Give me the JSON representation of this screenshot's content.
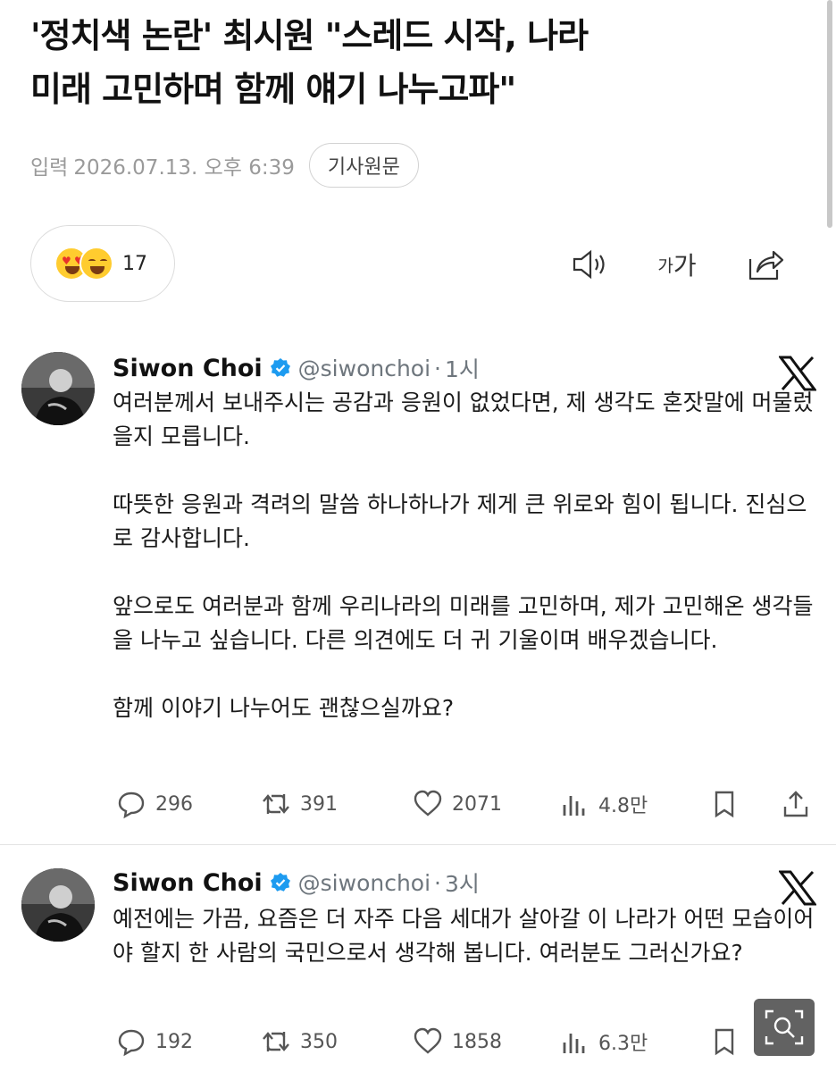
{
  "article": {
    "headline_line1": "'정치색 논란' 최시원 \"스레드 시작, 나라",
    "headline_line2": "미래 고민하며 함께 얘기 나누고파\"",
    "date_prefix": "입력",
    "date": "2026.07.13. 오후 6:39",
    "original_button": "기사원문",
    "reaction_count": "17",
    "font_size_small": "가",
    "font_size_large": "가"
  },
  "tweets": [
    {
      "name": "Siwon Choi",
      "handle": "@siwonchoi",
      "separator": "·",
      "time": "1시",
      "paragraphs": [
        "여러분께서 보내주시는 공감과 응원이 없었다면, 제 생각도 혼잣말에 머물렀을지 모릅니다.",
        "따뜻한 응원과 격려의 말씀 하나하나가 제게 큰 위로와 힘이 됩니다. 진심으로 감사합니다.",
        "앞으로도 여러분과 함께 우리나라의 미래를 고민하며, 제가 고민해온 생각들을 나누고 싶습니다. 다른 의견에도 더 귀 기울이며 배우겠습니다.",
        "함께 이야기 나누어도 괜찮으실까요?"
      ],
      "replies": "296",
      "retweets": "391",
      "likes": "2071",
      "views": "4.8만"
    },
    {
      "name": "Siwon Choi",
      "handle": "@siwonchoi",
      "separator": "·",
      "time": "3시",
      "paragraphs": [
        "예전에는 가끔, 요즘은 더 자주 다음 세대가 살아갈 이 나라가 어떤 모습이어야 할지 한 사람의 국민으로서 생각해 봅니다. 여러분도 그러신가요?"
      ],
      "replies": "192",
      "retweets": "350",
      "likes": "1858",
      "views": "6.3만"
    }
  ],
  "icons": {
    "verified": "verified-badge-icon",
    "x_logo": "x-logo-icon",
    "reply": "reply-icon",
    "retweet": "retweet-icon",
    "like": "heart-icon",
    "views": "views-chart-icon",
    "bookmark": "bookmark-icon",
    "share": "share-icon",
    "speaker": "speaker-icon",
    "zoom": "zoom-search-icon"
  },
  "colors": {
    "verified_blue": "#1d9bf0",
    "emoji_yellow": "#ffcc2f",
    "meta_gray": "#9a9a9a",
    "action_gray": "#555555"
  }
}
